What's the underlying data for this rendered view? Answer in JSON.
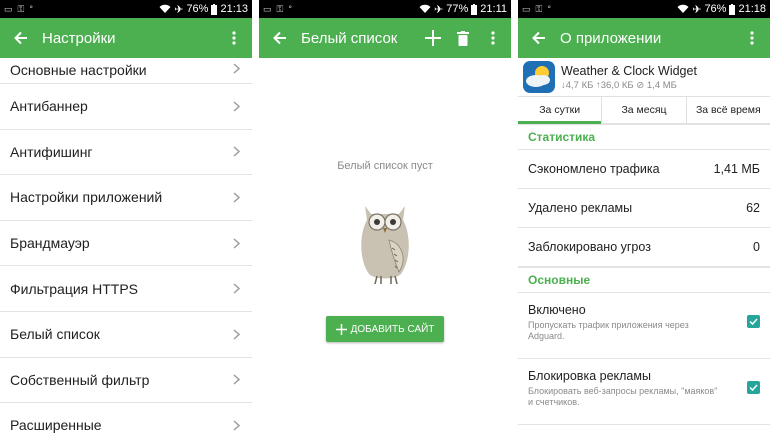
{
  "colors": {
    "primary": "#4caf50",
    "checkbox": "#26a69a",
    "status_bar": "#000000"
  },
  "screens": [
    {
      "status": {
        "battery": "76%",
        "time": "21:13"
      },
      "title": "Настройки",
      "items": [
        "Основные настройки",
        "Антибаннер",
        "Антифишинг",
        "Настройки приложений",
        "Брандмауэр",
        "Фильтрация HTTPS",
        "Белый список",
        "Собственный фильтр",
        "Расширенные"
      ]
    },
    {
      "status": {
        "battery": "77%",
        "time": "21:11"
      },
      "title": "Белый список",
      "empty_text": "Белый список пуст",
      "add_button": "ДОБАВИТЬ САЙТ"
    },
    {
      "status": {
        "battery": "76%",
        "time": "21:18"
      },
      "title": "О приложении",
      "app": {
        "name": "Weather & Clock Widget",
        "stats": "↓4,7 КБ ↑36,0 КБ ⊘ 1,4 МБ"
      },
      "tabs": [
        "За сутки",
        "За месяц",
        "За всё время"
      ],
      "stats_header": "Статистика",
      "stats": [
        {
          "label": "Сэкономлено трафика",
          "value": "1,41 МБ"
        },
        {
          "label": "Удалено рекламы",
          "value": "62"
        },
        {
          "label": "Заблокировано угроз",
          "value": "0"
        }
      ],
      "main_header": "Основные",
      "toggles": [
        {
          "title": "Включено",
          "desc": "Пропускать трафик приложения через Adguard."
        },
        {
          "title": "Блокировка рекламы",
          "desc": "Блокировать веб-запросы рекламы, \"маяков\" и счетчиков."
        }
      ]
    }
  ]
}
